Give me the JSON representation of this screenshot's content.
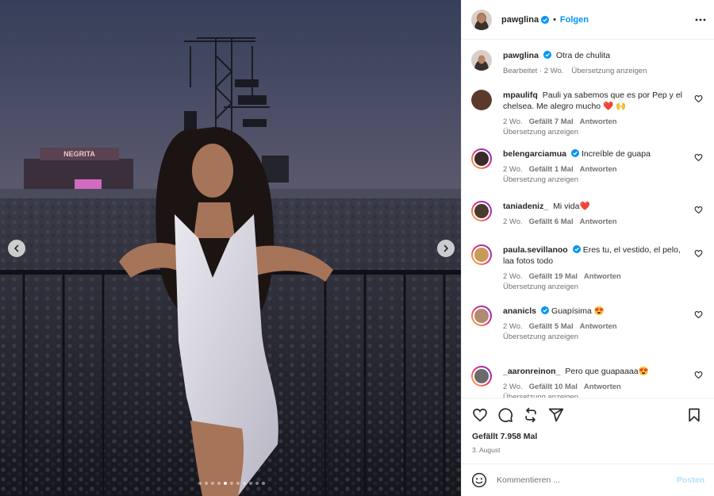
{
  "post": {
    "author": "pawglina",
    "verified": true,
    "separator": "•",
    "follow_label": "Folgen",
    "caption": {
      "user": "pawglina",
      "text": "Otra de chulita",
      "meta_edited": "Bearbeitet",
      "meta_time": "2 Wo.",
      "translate": "Übersetzung anzeigen"
    },
    "carousel": {
      "total": 11,
      "active_index": 4
    }
  },
  "comments": [
    {
      "user": "mpaulifq",
      "verified": false,
      "text": "Pauli ya sabemos que es por Pep y el chelsea. Me alegro mucho ❤️ 🙌",
      "time": "2 Wo.",
      "likes": "Gefällt 7 Mal",
      "reply": "Antworten",
      "translate": "Übersetzung anzeigen",
      "avatar_color": "#5b3a2c"
    },
    {
      "user": "belengarciamua",
      "verified": true,
      "text": "Increíble de guapa",
      "time": "2 Wo.",
      "likes": "Gefällt 1 Mal",
      "reply": "Antworten",
      "translate": "Übersetzung anzeigen",
      "avatar_color": "#3a2a2a"
    },
    {
      "user": "taniadeniz_",
      "verified": false,
      "text": "Mi vida❤️",
      "time": "2 Wo.",
      "likes": "Gefällt 6 Mal",
      "reply": "Antworten",
      "translate": "",
      "avatar_color": "#4a3a30"
    },
    {
      "user": "paula.sevillanoo",
      "verified": true,
      "text": "Eres tu, el vestido, el pelo, laa fotos todo",
      "time": "2 Wo.",
      "likes": "Gefällt 19 Mal",
      "reply": "Antworten",
      "translate": "Übersetzung anzeigen",
      "avatar_color": "#c89a5a"
    },
    {
      "user": "ananicls",
      "verified": true,
      "text": "Guapísima 😍",
      "time": "2 Wo.",
      "likes": "Gefällt 5 Mal",
      "reply": "Antworten",
      "translate": "Übersetzung anzeigen",
      "avatar_color": "#b08a74"
    },
    {
      "user": "_aaronreinon_",
      "verified": false,
      "text": "Pero que guapaaaa😍",
      "time": "2 Wo.",
      "likes": "Gefällt 10 Mal",
      "reply": "Antworten",
      "translate": "Übersetzung anzeigen",
      "avatar_color": "#6a6a6a"
    }
  ],
  "footer": {
    "likes": "Gefällt 7.958 Mal",
    "date": "3. August",
    "comment_placeholder": "Kommentieren ...",
    "post_label": "Posten"
  },
  "scene": {
    "stage_sign": "NEGRITA",
    "sky_top": "#3d4660",
    "sky_bottom": "#b58a84"
  },
  "colors": {
    "accent": "#0095f6",
    "verified": "#0095f6",
    "post_disabled": "#b2dffc",
    "story_ring": [
      "#f9ce34",
      "#ee2a7b",
      "#6228d7"
    ]
  },
  "icons": {
    "more": "more-icon",
    "like": "heart-icon",
    "comment": "comment-icon",
    "share": "repost-icon",
    "send": "send-icon",
    "save": "bookmark-icon",
    "emoji": "emoji-icon",
    "prev": "chevron-left-icon",
    "next": "chevron-right-icon"
  }
}
